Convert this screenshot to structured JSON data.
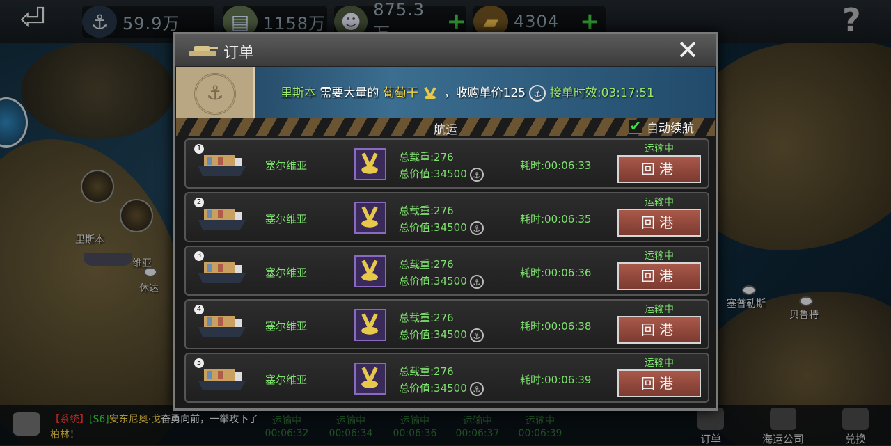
{
  "resources": [
    {
      "icon": "anchor-icon",
      "value": "59.9万",
      "plus": false
    },
    {
      "icon": "money-stack-icon",
      "value": "1158万",
      "plus": false
    },
    {
      "icon": "soldier-icon",
      "value": "875.3万",
      "plus": true
    },
    {
      "icon": "gold-bars-icon",
      "value": "4304",
      "plus": true
    }
  ],
  "plus_symbol": "+",
  "help_symbol": "?",
  "back_symbol": "⏎",
  "map_labels": {
    "lisbon": "里斯本",
    "serbia": "维亚",
    "ceuta": "休达",
    "cyprus": "塞普勒斯",
    "beirut": "贝鲁特"
  },
  "modal": {
    "title": "订单",
    "close_symbol": "✕",
    "banner": {
      "city": "里斯本",
      "needs": "需要大量的",
      "goods": "葡萄干",
      "price_prefix": "，收购单价",
      "price": "125",
      "deadline_label": "接单时效:",
      "deadline": "03:17:51"
    },
    "section_label": "航运",
    "auto_label": "自动续航",
    "auto_checked": true,
    "check_symbol": "✔",
    "rows": [
      {
        "num": "1",
        "dest": "塞尔维亚",
        "weight": "总载重:276",
        "value": "总价值:34500",
        "time": "耗时:00:06:33",
        "status": "运输中",
        "button": "回港"
      },
      {
        "num": "2",
        "dest": "塞尔维亚",
        "weight": "总载重:276",
        "value": "总价值:34500",
        "time": "耗时:00:06:35",
        "status": "运输中",
        "button": "回港"
      },
      {
        "num": "3",
        "dest": "塞尔维亚",
        "weight": "总载重:276",
        "value": "总价值:34500",
        "time": "耗时:00:06:36",
        "status": "运输中",
        "button": "回港"
      },
      {
        "num": "4",
        "dest": "塞尔维亚",
        "weight": "总载重:276",
        "value": "总价值:34500",
        "time": "耗时:00:06:38",
        "status": "运输中",
        "button": "回港"
      },
      {
        "num": "5",
        "dest": "塞尔维亚",
        "weight": "总载重:276",
        "value": "总价值:34500",
        "time": "耗时:00:06:39",
        "status": "运输中",
        "button": "回港"
      }
    ]
  },
  "chat": {
    "tag": "【系统】",
    "server": "[S6]",
    "name": "安东尼奥·戈",
    "text1": "奋勇向前，一举攻下了",
    "city": "柏林",
    "text2": "！"
  },
  "bottom_ghosts": [
    {
      "status": "运输中",
      "time": "00:06:32"
    },
    {
      "status": "运输中",
      "time": "00:06:34"
    },
    {
      "status": "运输中",
      "time": "00:06:36"
    },
    {
      "status": "运输中",
      "time": "00:06:37"
    },
    {
      "status": "运输中",
      "time": "00:06:39"
    }
  ],
  "bottom_nav": [
    {
      "icon": "order-scroll-icon",
      "label": "订单"
    },
    {
      "icon": "shipping-company-icon",
      "label": "海运公司"
    },
    {
      "icon": "exchange-globe-icon",
      "label": "兑换"
    }
  ],
  "colors": {
    "green_text": "#7ee06e",
    "button_red": "#a9594a",
    "plus_green": "#3fbf3f"
  }
}
